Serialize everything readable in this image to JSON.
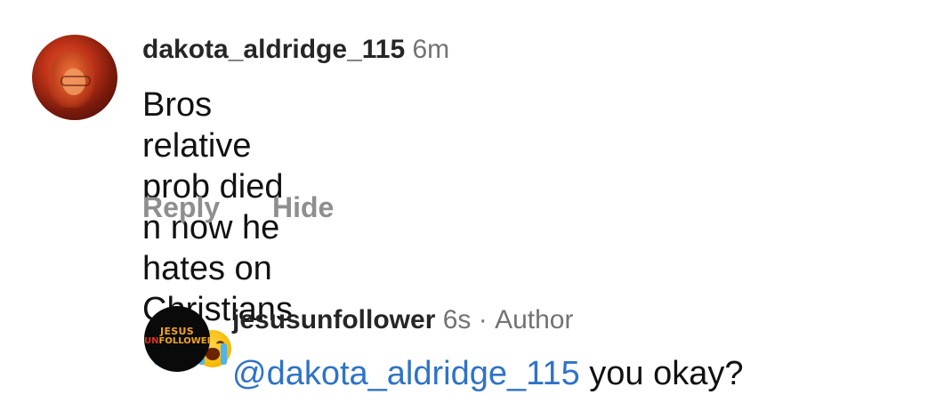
{
  "comments": [
    {
      "username": "dakota_aldridge_115",
      "time": "6m",
      "text_line1": "Bros relative prob died n now he hates on",
      "text_line2": "Christians",
      "emoji_name": "loudly-crying-face",
      "actions": {
        "reply": "Reply",
        "hide": "Hide"
      }
    },
    {
      "username": "jesusunfollower",
      "time": "6s",
      "separator": "·",
      "author_tag": "Author",
      "mention": "@dakota_aldridge_115",
      "text": "you okay?",
      "logo": {
        "line1": "JESUS",
        "line2_prefix": "UN",
        "line2_rest": "FOLLOWER"
      }
    }
  ],
  "colors": {
    "username": "#262626",
    "meta": "#737373",
    "action": "#8e8e8e",
    "mention": "#2f73c7",
    "logo_gold": "#f1a51f",
    "logo_red": "#e0301e"
  }
}
